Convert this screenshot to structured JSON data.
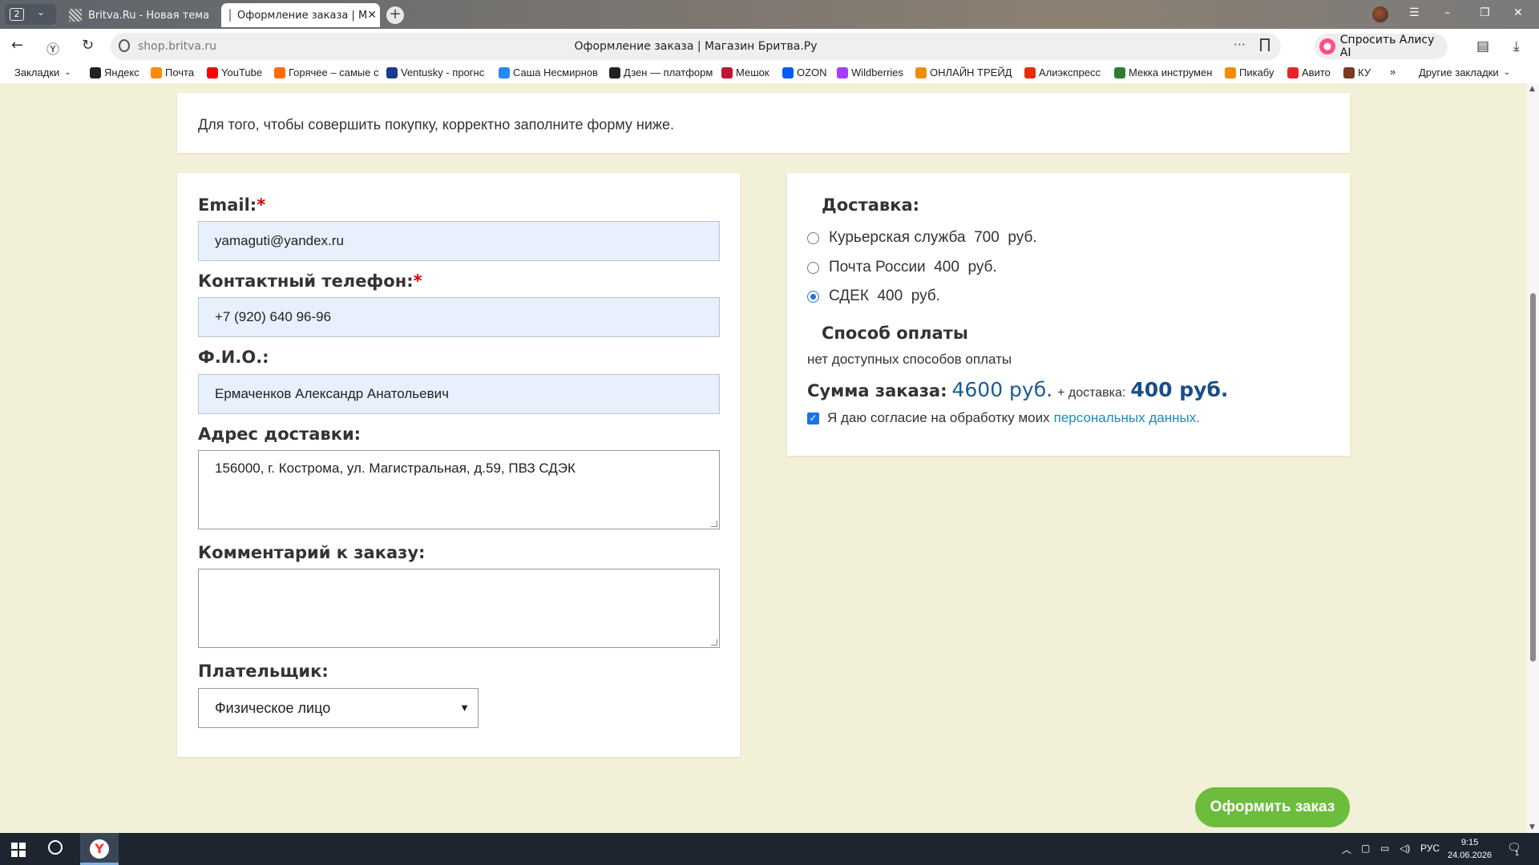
{
  "browser": {
    "tab_count": "2",
    "tabs": [
      {
        "title": "Britva.Ru - Новая тема"
      },
      {
        "title": "Оформление заказа | М"
      }
    ],
    "address": {
      "domain": "shop.britva.ru",
      "page_title": "Оформление заказа | Магазин Бритва.Ру"
    },
    "alice_label": "Спросить Алису AI",
    "bookmarks_label": "Закладки",
    "bookmarks": [
      {
        "label": "Яндекс",
        "color": "#222222"
      },
      {
        "label": "Почта",
        "color": "#ff8a00"
      },
      {
        "label": "YouTube",
        "color": "#ff0000"
      },
      {
        "label": "Горячее – самые с",
        "color": "#ff6a00"
      },
      {
        "label": "Ventusky - прогнс",
        "color": "#1e3a8a"
      },
      {
        "label": "Саша Несмирнов",
        "color": "#2787f5"
      },
      {
        "label": "Дзен — платформ",
        "color": "#222222"
      },
      {
        "label": "Мешок",
        "color": "#c0152f"
      },
      {
        "label": "OZON",
        "color": "#005bff"
      },
      {
        "label": "Wildberries",
        "color": "#a73afd"
      },
      {
        "label": "ОНЛАЙН ТРЕЙД",
        "color": "#f08c00"
      },
      {
        "label": "Алиэкспресс",
        "color": "#e62e04"
      },
      {
        "label": "Мекка инструмен",
        "color": "#2e7d32"
      },
      {
        "label": "Пикабу",
        "color": "#f08c00"
      },
      {
        "label": "Авито",
        "color": "#e8242a"
      },
      {
        "label": "КУ",
        "color": "#7a3b1e"
      }
    ],
    "other_bookmarks": "Другие закладки"
  },
  "page": {
    "notice": "Для того, чтобы совершить покупку, корректно заполните форму ниже.",
    "form": {
      "email_label": "Email:",
      "email_value": "yamaguti@yandex.ru",
      "phone_label": "Контактный телефон:",
      "phone_value": "+7 (920) 640 96-96",
      "fio_label": "Ф.И.О.:",
      "fio_value": "Ермаченков Александр Анатольевич",
      "address_label": "Адрес доставки:",
      "address_value": "156000, г. Кострома, ул. Магистральная, д.59, ПВЗ СДЭК",
      "comment_label": "Комментарий к заказу:",
      "comment_value": "",
      "payer_label": "Плательщик:",
      "payer_selected": "Физическое лицо",
      "required_mark": "*"
    },
    "delivery": {
      "heading": "Доставка:",
      "options": [
        {
          "label": "Курьерская служба  700  руб.",
          "checked": false
        },
        {
          "label": "Почта России  400  руб.",
          "checked": false
        },
        {
          "label": "СДЕК  400  руб.",
          "checked": true
        }
      ]
    },
    "payment": {
      "heading": "Способ оплаты",
      "note": "нет доступных способов оплаты"
    },
    "summary": {
      "label": "Сумма заказа:",
      "amount": "4600 руб.",
      "plus_delivery": "+ доставка:",
      "delivery_amount": "400 руб."
    },
    "consent": {
      "text": "Я даю согласие на обработку моих",
      "link": "персональных данных.",
      "checked": true
    },
    "submit_label": "Оформить заказ"
  },
  "taskbar": {
    "lang": "РУС",
    "time": "9:15",
    "date": "24.06.2026",
    "notif_count": "1"
  }
}
